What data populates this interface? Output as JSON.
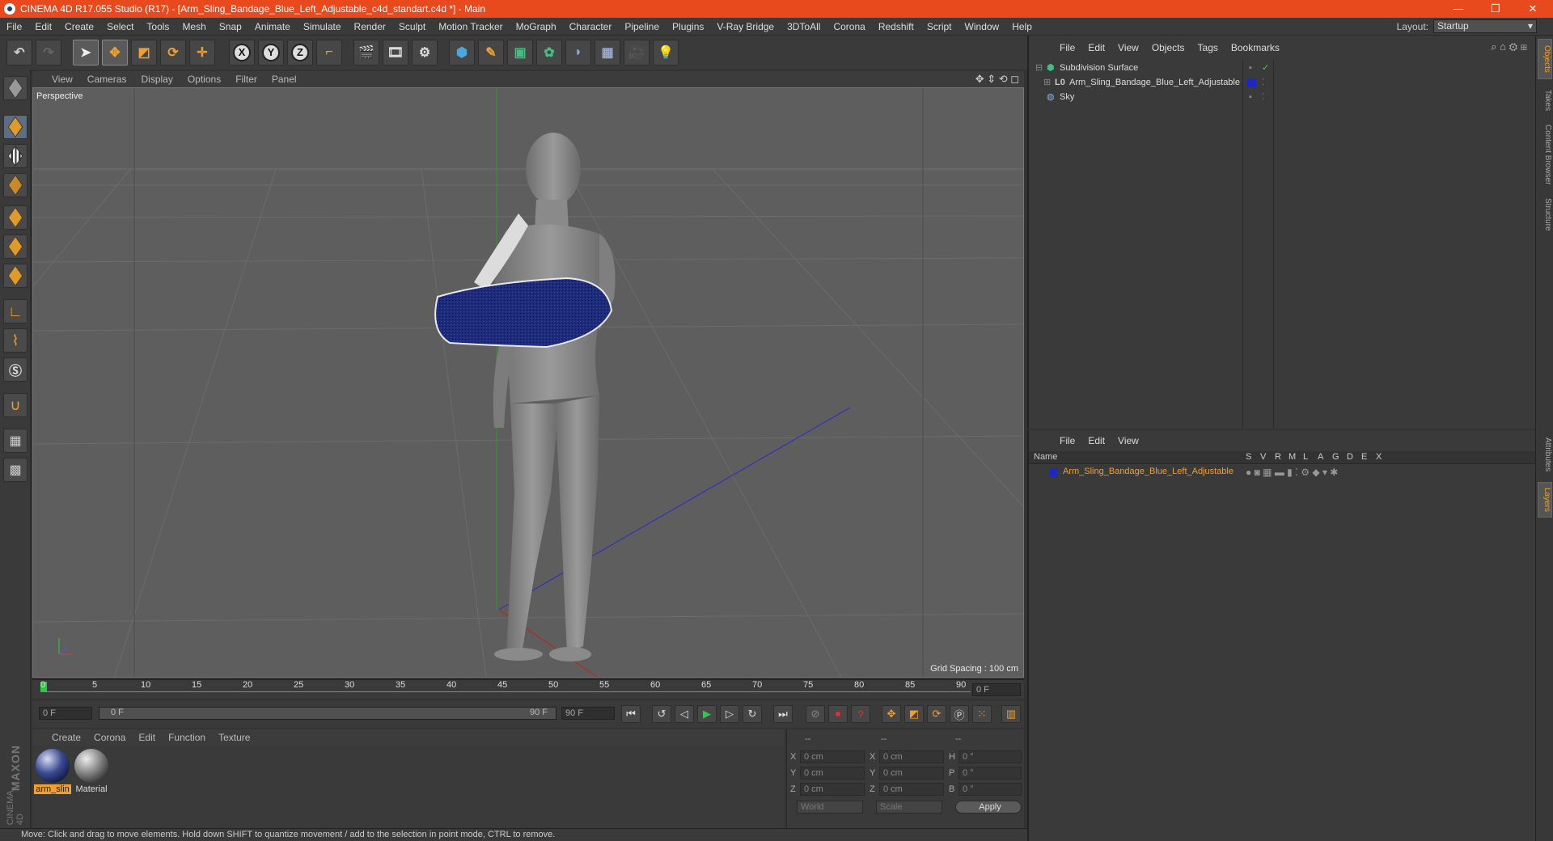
{
  "window": {
    "title": "CINEMA 4D R17.055 Studio (R17) - [Arm_Sling_Bandage_Blue_Left_Adjustable_c4d_standart.c4d *] - Main",
    "controls": [
      "—",
      "❐",
      "✕"
    ]
  },
  "menubar": {
    "items": [
      "File",
      "Edit",
      "Create",
      "Select",
      "Tools",
      "Mesh",
      "Snap",
      "Animate",
      "Simulate",
      "Render",
      "Sculpt",
      "Motion Tracker",
      "MoGraph",
      "Character",
      "Pipeline",
      "Plugins",
      "V-Ray Bridge",
      "3DToAll",
      "Corona",
      "Redshift",
      "Script",
      "Window",
      "Help"
    ],
    "layout_label": "Layout:",
    "layout_value": "Startup"
  },
  "toolbar": {
    "axis_x": "X",
    "axis_y": "Y",
    "axis_z": "Z"
  },
  "viewport": {
    "menu": [
      "View",
      "Cameras",
      "Display",
      "Options",
      "Filter",
      "Panel"
    ],
    "label": "Perspective",
    "grid_spacing": "Grid Spacing : 100 cm"
  },
  "timeline": {
    "ticks": [
      "0",
      "5",
      "10",
      "15",
      "20",
      "25",
      "30",
      "35",
      "40",
      "45",
      "50",
      "55",
      "60",
      "65",
      "70",
      "75",
      "80",
      "85",
      "90"
    ],
    "current_frame": "0 F",
    "start_field": "0 F",
    "range_start": "0 F",
    "range_end": "90 F",
    "end_field": "90 F"
  },
  "materials": {
    "menu": [
      "Create",
      "Corona",
      "Edit",
      "Function",
      "Texture"
    ],
    "items": [
      {
        "name": "arm_slin",
        "selected": true
      },
      {
        "name": "Material",
        "selected": false
      }
    ]
  },
  "coords": {
    "headers": [
      "--",
      "--",
      "--"
    ],
    "rows": [
      {
        "a_label": "X",
        "a_val": "0 cm",
        "b_label": "X",
        "b_val": "0 cm",
        "c_label": "H",
        "c_val": "0 °"
      },
      {
        "a_label": "Y",
        "a_val": "0 cm",
        "b_label": "Y",
        "b_val": "0 cm",
        "c_label": "P",
        "c_val": "0 °"
      },
      {
        "a_label": "Z",
        "a_val": "0 cm",
        "b_label": "Z",
        "b_val": "0 cm",
        "c_label": "B",
        "c_val": "0 °"
      }
    ],
    "world": "World",
    "scale": "Scale",
    "apply": "Apply"
  },
  "status": "Move: Click and drag to move elements. Hold down SHIFT to quantize movement / add to the selection in point mode, CTRL to remove.",
  "objects": {
    "menu": [
      "File",
      "Edit",
      "View",
      "Objects",
      "Tags",
      "Bookmarks"
    ],
    "rows": [
      {
        "name": "Subdivision Surface"
      },
      {
        "name": "Arm_Sling_Bandage_Blue_Left_Adjustable"
      },
      {
        "name": "Sky"
      }
    ]
  },
  "layers": {
    "menu": [
      "File",
      "Edit",
      "View"
    ],
    "name_header": "Name",
    "flags": [
      "S",
      "V",
      "R",
      "M",
      "L",
      "A",
      "G",
      "D",
      "E",
      "X"
    ],
    "rows": [
      {
        "name": "Arm_Sling_Bandage_Blue_Left_Adjustable"
      }
    ]
  },
  "sidetabs": [
    "Objects",
    "Takes",
    "Content Browser",
    "Structure",
    "Attributes",
    "Layers"
  ],
  "brand": {
    "maxon": "MAXON",
    "c4d": "CINEMA 4D"
  },
  "colors": {
    "accent": "#e8491d",
    "sling_blue": "#1f2a78",
    "layer_blue": "#1a28c8",
    "highlight_orange": "#f0a030"
  }
}
